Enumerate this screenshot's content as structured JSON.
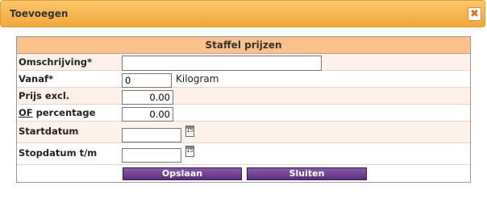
{
  "dialog": {
    "title": "Toevoegen",
    "close_glyph": "✖",
    "close_icon": "close-icon"
  },
  "panel": {
    "header": "Staffel prijzen"
  },
  "form": {
    "omschrijving": {
      "label": "Omschrijving*",
      "value": ""
    },
    "vanaf": {
      "label": "Vanaf*",
      "value": "0",
      "unit": "Kilogram"
    },
    "prijs": {
      "label": "Prijs excl.",
      "value": "0.00"
    },
    "percentage": {
      "label_prefix": "OF",
      "label_suffix": " percentage",
      "value": "0.00"
    },
    "startdatum": {
      "label": "Startdatum",
      "value": "",
      "calendar_icon": "calendar-icon",
      "calendar_text": "15"
    },
    "stopdatum": {
      "label": "Stopdatum t/m",
      "value": "",
      "calendar_icon": "calendar-icon",
      "calendar_text": "15"
    }
  },
  "buttons": {
    "save": "Opslaan",
    "close": "Sluiten"
  },
  "colors": {
    "title_bar": "#f2a73b",
    "panel_header": "#fbc38b",
    "button": "#5c2f7e"
  }
}
